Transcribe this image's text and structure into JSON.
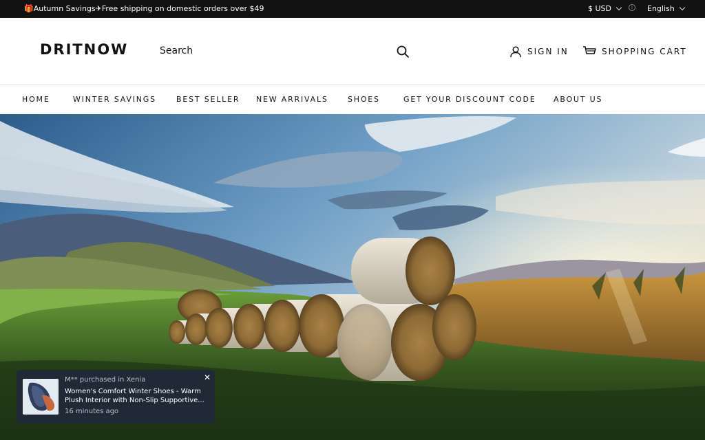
{
  "announcement": {
    "text": "🎁Autumn Savings✈Free shipping on domestic orders over $49",
    "currency": "$ USD",
    "language": "English"
  },
  "header": {
    "logo": "DRITNOW",
    "search_placeholder": "Search",
    "sign_in": "SIGN IN",
    "cart": "SHOPPING CART"
  },
  "nav": {
    "items": [
      "HOME",
      "WINTER SAVINGS",
      "BEST SELLER",
      "NEW ARRIVALS",
      "SHOES",
      "GET YOUR DISCOUNT CODE",
      "ABOUT US"
    ]
  },
  "popup": {
    "buyer": "M** purchased in Xenia",
    "product": "Women's Comfort Winter Shoes - Warm Plush Interior with Non-Slip Supportive...",
    "time": "16 minutes ago"
  },
  "icons": {
    "search": "search-icon",
    "user": "user-icon",
    "cart": "cart-icon",
    "close": "close-icon",
    "chevron": "chevron-down-icon",
    "info": "info-icon"
  }
}
